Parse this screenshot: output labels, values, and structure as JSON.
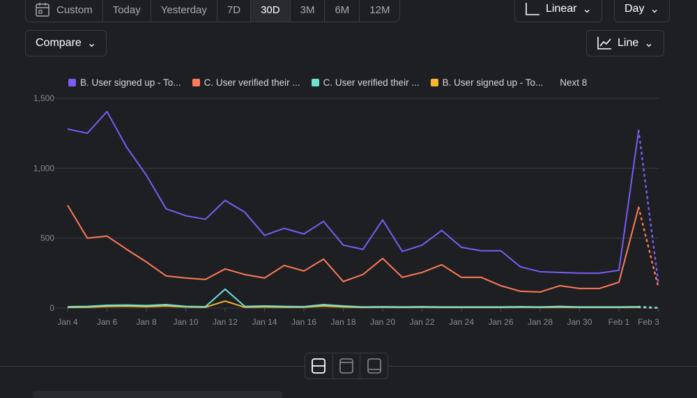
{
  "date_range": {
    "custom": "Custom",
    "options": [
      "Today",
      "Yesterday",
      "7D",
      "30D",
      "3M",
      "6M",
      "12M"
    ],
    "selected": "30D"
  },
  "compare": "Compare",
  "scale": "Linear",
  "interval": "Day",
  "chart_type": "Line",
  "chart_data": {
    "type": "line",
    "ylim": [
      0,
      1500
    ],
    "yticks": [
      "0",
      "500",
      "1,000",
      "1,500"
    ],
    "ytick_values": [
      0,
      500,
      1000,
      1500
    ],
    "xtick_labels": [
      "Jan 4",
      "Jan 6",
      "Jan 8",
      "Jan 10",
      "Jan 12",
      "Jan 14",
      "Jan 16",
      "Jan 18",
      "Jan 20",
      "Jan 22",
      "Jan 24",
      "Jan 26",
      "Jan 28",
      "Jan 30",
      "Feb 1",
      "Feb 3"
    ],
    "xtick_days": [
      0,
      2,
      4,
      6,
      8,
      10,
      12,
      14,
      16,
      18,
      20,
      22,
      24,
      26,
      28,
      30
    ],
    "incomplete_from_day": 29,
    "legend_more": "Next 8",
    "series": [
      {
        "name": "B. User signed up - To...",
        "color": "#7b5cf5",
        "values": [
          1280,
          1250,
          1405,
          1150,
          950,
          710,
          660,
          635,
          770,
          685,
          520,
          570,
          530,
          620,
          450,
          420,
          630,
          405,
          450,
          555,
          435,
          410,
          410,
          295,
          260,
          255,
          250,
          250,
          270,
          1270,
          180
        ]
      },
      {
        "name": "C. User verified their ...",
        "color": "#ff7a59",
        "values": [
          735,
          500,
          515,
          420,
          330,
          230,
          215,
          205,
          280,
          240,
          215,
          305,
          265,
          350,
          190,
          240,
          355,
          220,
          255,
          310,
          220,
          220,
          160,
          120,
          115,
          160,
          140,
          140,
          185,
          720,
          150
        ]
      },
      {
        "name": "C. User verified their ...",
        "color": "#6fe3d6",
        "values": [
          10,
          12,
          20,
          22,
          18,
          25,
          12,
          10,
          135,
          12,
          15,
          12,
          10,
          25,
          15,
          8,
          10,
          8,
          10,
          8,
          8,
          8,
          8,
          10,
          8,
          12,
          8,
          8,
          8,
          10,
          2
        ]
      },
      {
        "name": "B. User signed up - To...",
        "color": "#f5b82e",
        "values": [
          5,
          6,
          12,
          14,
          10,
          15,
          8,
          6,
          50,
          6,
          8,
          6,
          6,
          15,
          8,
          5,
          6,
          5,
          6,
          5,
          5,
          5,
          5,
          6,
          5,
          6,
          5,
          5,
          5,
          6,
          1
        ]
      }
    ]
  }
}
